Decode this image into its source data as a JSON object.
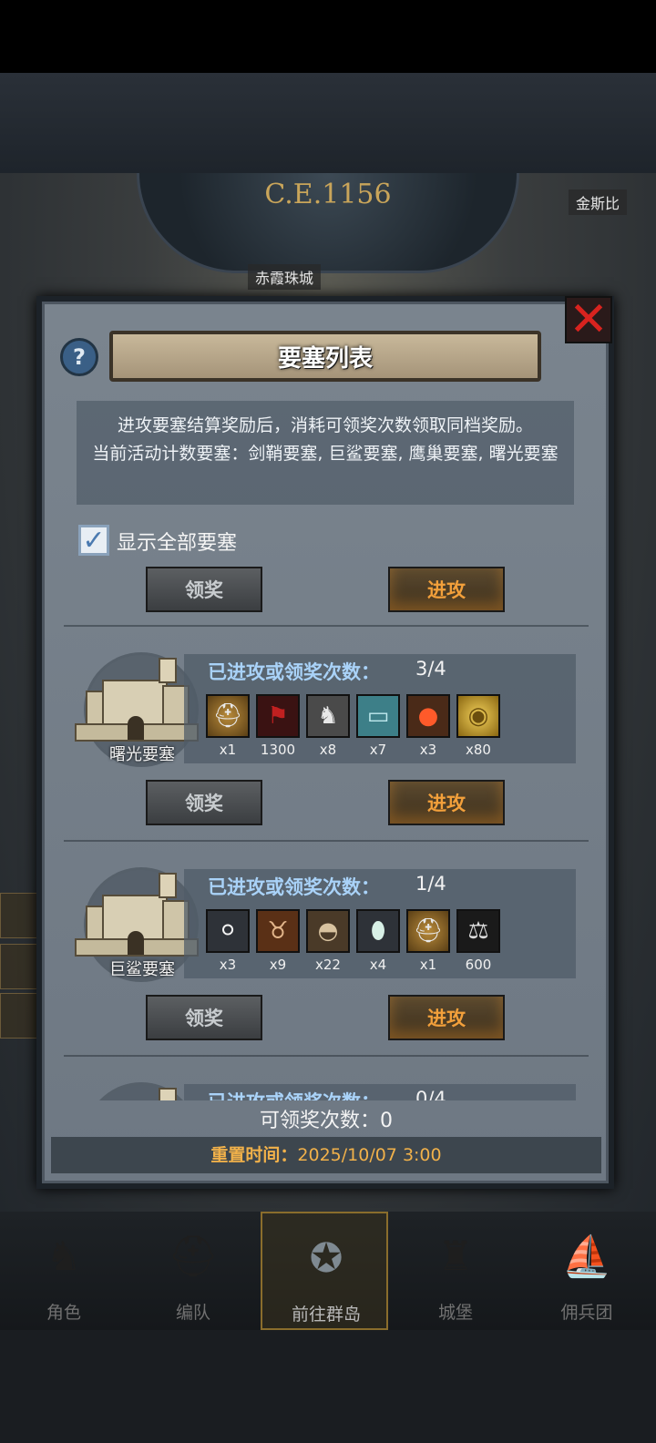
{
  "header": {
    "era": "C.E.1156",
    "map_labels": [
      "赤霞珠城",
      "金斯比"
    ]
  },
  "dialog": {
    "title": "要塞列表",
    "help_icon": "question-icon",
    "close_icon": "close-x-icon",
    "description_line1": "进攻要塞结算奖励后，消耗可领奖次数领取同档奖励。",
    "description_line2": "当前活动计数要塞：剑鞘要塞, 巨鲨要塞, 鹰巢要塞, 曙光要塞",
    "show_all_label": "显示全部要塞",
    "show_all_checked": true,
    "claim_label": "领奖",
    "attack_label": "进攻",
    "count_label": "已进攻或领奖次数：",
    "fortresses": [
      {
        "name": "曙光要塞",
        "count": "3/4",
        "rewards": [
          {
            "icon": "helmet-medal-icon",
            "qty": "x1"
          },
          {
            "icon": "red-banner-icon",
            "qty": "1300"
          },
          {
            "icon": "horse-icon",
            "qty": "x8"
          },
          {
            "icon": "cloth-roll-icon",
            "qty": "x7"
          },
          {
            "icon": "berries-icon",
            "qty": "x3"
          },
          {
            "icon": "gold-coin-icon",
            "qty": "x80"
          }
        ]
      },
      {
        "name": "巨鲨要塞",
        "count": "1/4",
        "rewards": [
          {
            "icon": "pearls-icon",
            "qty": "x3"
          },
          {
            "icon": "bull-icon",
            "qty": "x9"
          },
          {
            "icon": "sack-icon",
            "qty": "x22"
          },
          {
            "icon": "egg-icon",
            "qty": "x4"
          },
          {
            "icon": "helmet-medal-icon",
            "qty": "x1"
          },
          {
            "icon": "scales-banner-icon",
            "qty": "600"
          }
        ]
      },
      {
        "name": "",
        "count": "0/4",
        "rewards": []
      }
    ],
    "claimable_count_label": "可领奖次数：",
    "claimable_count": "0",
    "reset_label": "重置时间：",
    "reset_time": "2025/10/07 3:00"
  },
  "nav": {
    "tabs": [
      {
        "label": "角色",
        "icon": "knight-icon"
      },
      {
        "label": "编队",
        "icon": "helmet-icon"
      },
      {
        "label": "前往群岛",
        "icon": "compass-map-icon",
        "active": true
      },
      {
        "label": "城堡",
        "icon": "castle-icon"
      },
      {
        "label": "佣兵团",
        "icon": "ship-icon"
      }
    ]
  }
}
